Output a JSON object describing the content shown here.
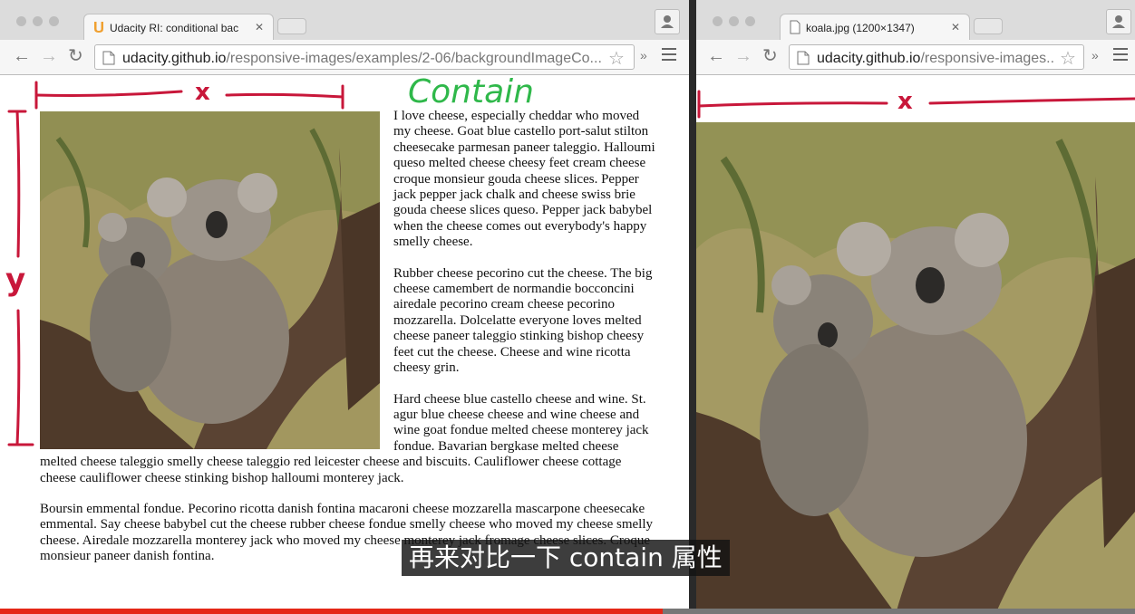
{
  "left_window": {
    "tab_title": "Udacity RI: conditional bac",
    "url_host": "udacity.github.io",
    "url_path": "/responsive-images/examples/2-06/backgroundImageCo...",
    "article_paragraphs": [
      "I love cheese, especially cheddar who moved my cheese. Goat blue castello port-salut stilton cheesecake parmesan paneer taleggio. Halloumi queso melted cheese cheesy feet cream cheese croque monsieur gouda cheese slices. Pepper jack pepper jack chalk and cheese swiss brie gouda cheese slices queso. Pepper jack babybel when the cheese comes out everybody's happy smelly cheese.",
      "Rubber cheese pecorino cut the cheese. The big cheese camembert de normandie bocconcini airedale pecorino cream cheese pecorino mozzarella. Dolcelatte everyone loves melted cheese paneer taleggio stinking bishop cheesy feet cut the cheese. Cheese and wine ricotta cheesy grin.",
      "Hard cheese blue castello cheese and wine. St. agur blue cheese cheese and wine cheese and wine goat fondue melted cheese monterey jack fondue. Bavarian bergkase melted cheese melted cheese taleggio smelly cheese taleggio red leicester cheese and biscuits. Cauliflower cheese cottage cheese cauliflower cheese stinking bishop halloumi monterey jack.",
      "Boursin emmental fondue. Pecorino ricotta danish fontina macaroni cheese mozzarella mascarpone cheesecake emmental. Say cheese babybel cut the cheese rubber cheese fondue smelly cheese who moved my cheese smelly cheese. Airedale mozzarella monterey jack who moved my cheese monterey jack fromage cheese slices. Croque monsieur paneer danish fontina."
    ],
    "annotations": {
      "heading": "Contain",
      "x_label": "x",
      "y_label": "y"
    }
  },
  "right_window": {
    "tab_title": "koala.jpg (1200×1347)",
    "url_host": "udacity.github.io",
    "url_path": "/responsive-images...",
    "annotations": {
      "x_label": "x"
    }
  },
  "subtitle": "再来对比一下 contain 属性",
  "video_progress": 0.584,
  "colors": {
    "annotation_red": "#c8173a",
    "annotation_green": "#2fb84a",
    "progress_red": "#e52717",
    "favicon_orange": "#f0a030"
  }
}
